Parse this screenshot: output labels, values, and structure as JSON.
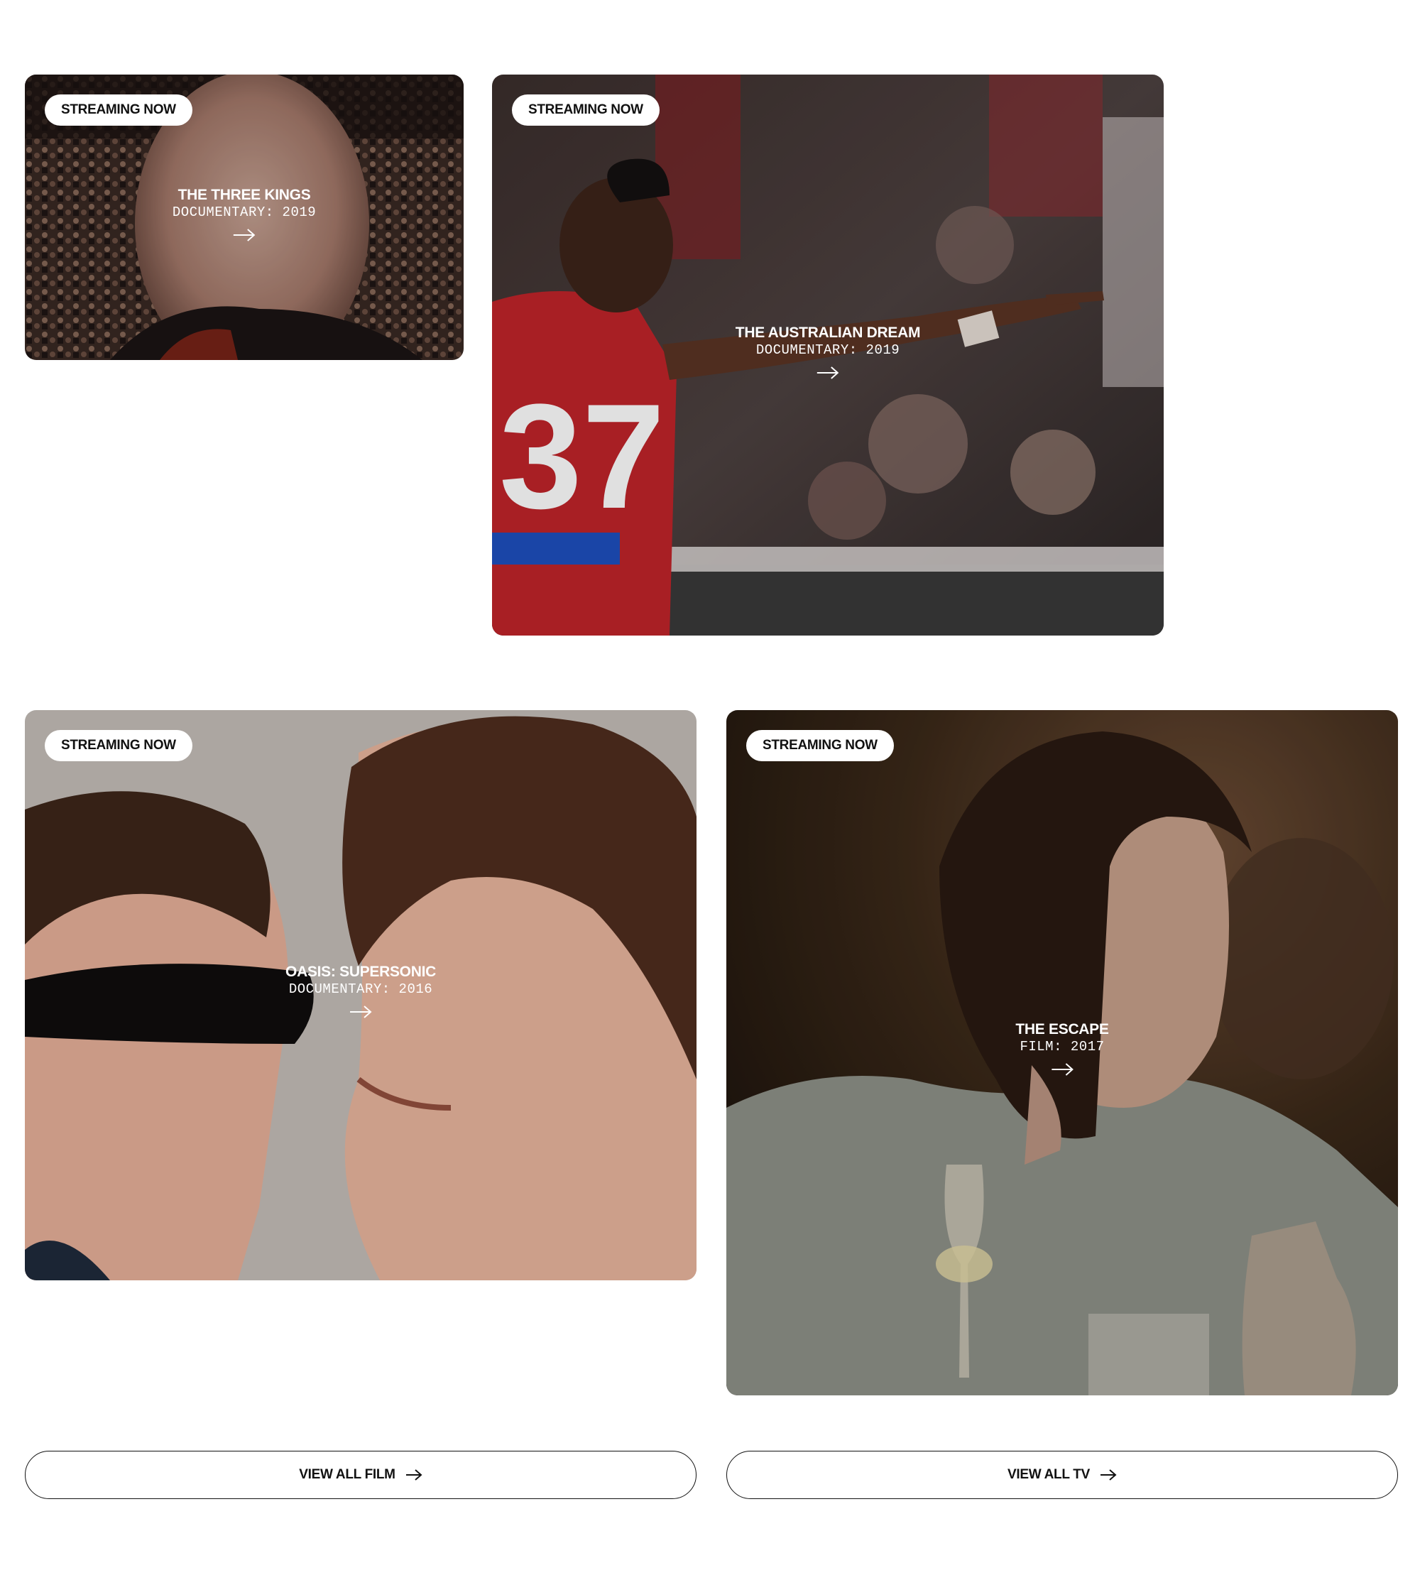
{
  "cards": [
    {
      "badge": "STREAMING NOW",
      "title": "THE THREE KINGS",
      "meta": "DOCUMENTARY: 2019"
    },
    {
      "badge": "STREAMING NOW",
      "title": "THE AUSTRALIAN DREAM",
      "meta": "DOCUMENTARY: 2019"
    },
    {
      "badge": "STREAMING NOW",
      "title": "OASIS: SUPERSONIC",
      "meta": "DOCUMENTARY: 2016"
    },
    {
      "badge": "STREAMING NOW",
      "title": "THE ESCAPE",
      "meta": "FILM: 2017"
    }
  ],
  "buttons": {
    "view_all_film": "VIEW ALL FILM",
    "view_all_tv": "VIEW ALL TV"
  }
}
